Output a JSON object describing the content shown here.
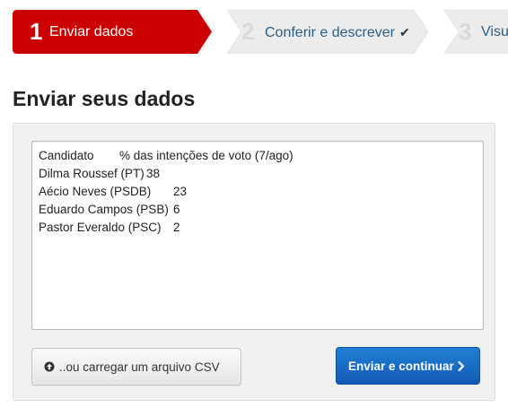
{
  "steps": [
    {
      "number": "1",
      "label": "Enviar dados",
      "state": "active"
    },
    {
      "number": "2",
      "label": "Conferir e descrever",
      "check": "✔",
      "state": "pending"
    },
    {
      "number": "3",
      "label": "Visua",
      "state": "pending"
    }
  ],
  "page_title": "Enviar seus dados",
  "data_input": {
    "value": "Candidato\t% das intenções de voto (7/ago)\nDilma Roussef (PT)\t38\nAécio Neves (PSDB)\t23\nEduardo Campos (PSB)\t6\nPastor Everaldo (PSC)\t2"
  },
  "upload_button": {
    "label": "..ou carregar um arquivo CSV",
    "icon": "upload-icon"
  },
  "submit_button": {
    "label": "Enviar e continuar",
    "icon": "chevron-right-icon"
  },
  "colors": {
    "active_step": "#cc0000",
    "pending_step": "#ececec",
    "primary_button": "#1a6ec8"
  }
}
